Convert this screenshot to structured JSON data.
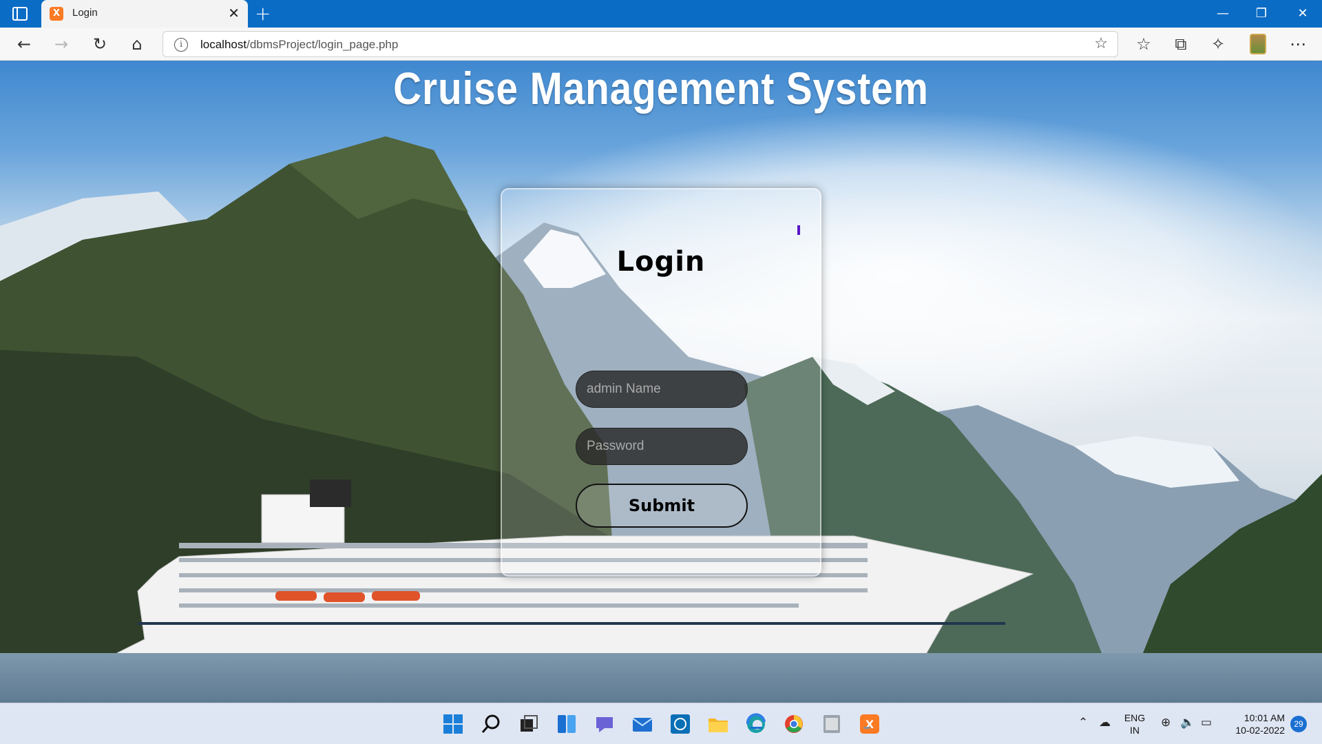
{
  "browser": {
    "tab": {
      "title": "Login",
      "favicon": "xampp-icon"
    },
    "address": {
      "host": "localhost",
      "path": "/dbmsProject/login_page.php"
    }
  },
  "page": {
    "site_title": "Cruise Management System",
    "login": {
      "heading": "Login",
      "name_placeholder": "admin Name",
      "password_placeholder": "Password",
      "submit_label": "Submit"
    }
  },
  "taskbar": {
    "apps": [
      "start-icon",
      "search-icon",
      "task-view-icon",
      "widgets-icon",
      "teams-chat-icon",
      "mail-icon",
      "dell-icon",
      "file-explorer-icon",
      "edge-icon",
      "chrome-icon",
      "notepad-icon",
      "xampp-icon"
    ],
    "tray": {
      "language_line1": "ENG",
      "language_line2": "IN",
      "time": "10:01 AM",
      "date": "10-02-2022",
      "notification_count": "29"
    }
  },
  "colors": {
    "titlebar": "#0b6cc6",
    "accent": "#1b6fd1",
    "favicon": "#fb7a24"
  }
}
